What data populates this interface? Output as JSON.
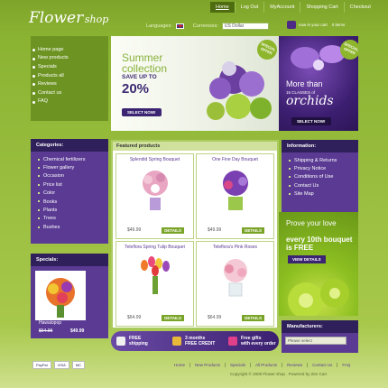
{
  "header": {
    "logo_main": "Flower",
    "logo_sub": "shop",
    "nav": [
      "Home",
      "Log Out",
      "MyAccount",
      "Shopping Cart",
      "Checkout"
    ],
    "languages_label": "Languages:",
    "currencies_label": "Currencies:",
    "currency_selected": "US Dollar",
    "cart_label": "now in your cart",
    "cart_items": "0 items"
  },
  "left_nav": [
    "Home page",
    "New products",
    "Specials",
    "Products all",
    "Reviews",
    "Contact us",
    "FAQ"
  ],
  "categories": {
    "title": "Categories:",
    "items": [
      "Chemical fertilizers",
      "Flower gallery",
      "Occasion",
      "Price list",
      "Color",
      "Books",
      "Plants",
      "Trees",
      "Bushes"
    ]
  },
  "banner_main": {
    "line1": "Summer",
    "line2": "collection",
    "line3": "SAVE UP TO",
    "line4": "20%",
    "button": "SELECT NOW!",
    "tag": "SPECIAL OFFER"
  },
  "banner_side": {
    "line1": "More than",
    "line2": "15 CLASSES of",
    "line3": "orchids",
    "button": "SELECT NOW!",
    "tag": "SPECIAL OFFER"
  },
  "featured": {
    "title": "Featured products",
    "details_label": "DETAILS",
    "products": [
      {
        "name": "Splendid Spring Bouquet",
        "price": "$49.99"
      },
      {
        "name": "One Fine Day Bouquet",
        "price": "$49.99"
      },
      {
        "name": "Teleflora Spring Tulip Bouquet",
        "price": "$64.99"
      },
      {
        "name": "Teleflora's Pink Roses",
        "price": "$64.99"
      }
    ]
  },
  "promo": [
    {
      "l1": "FREE",
      "l2": "shipping"
    },
    {
      "l1": "3 months",
      "l2": "FREE CREDIT"
    },
    {
      "l1": "Free gifts",
      "l2": "with every order"
    }
  ],
  "information": {
    "title": "Information:",
    "items": [
      "Shipping & Returns",
      "Privacy Notice",
      "Conditions of Use",
      "Contact Us",
      "Site Map"
    ]
  },
  "ad": {
    "line1": "Prove your love",
    "line2": "every 10th bouquet is FREE",
    "button": "VIEW DETAILS"
  },
  "specials": {
    "title": "Specials:",
    "name": "Hawaiopop",
    "old_price": "$64.99",
    "new_price": "$49.99"
  },
  "manufacturers": {
    "title": "Manufacturers:",
    "select": "Please select"
  },
  "footer": {
    "links": [
      "Home",
      "New Products",
      "Specials",
      "All Products",
      "Reviews",
      "Contact Us",
      "FAQ"
    ],
    "copyright": "Copyright © 2009 Flower shop . Powered by Zen Cart",
    "pay": [
      "PayPal",
      "VISA",
      "MC"
    ]
  }
}
